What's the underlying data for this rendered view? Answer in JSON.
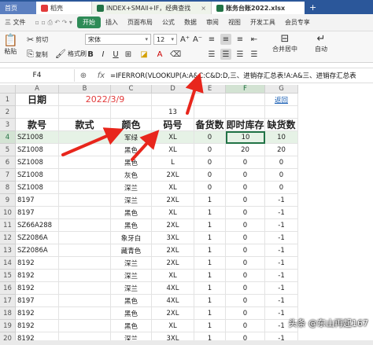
{
  "tabs": [
    {
      "label": "首页",
      "kind": "home"
    },
    {
      "label": "稻壳",
      "kind": "doc"
    },
    {
      "label": "INDEX+SMAll+IF，经典查找",
      "kind": "sheet1"
    },
    {
      "label": "账务台账2022.xlsx",
      "kind": "sheet2"
    }
  ],
  "tab_add": "+",
  "menu": {
    "file": "三 文件",
    "items": [
      "开始",
      "插入",
      "页面布局",
      "公式",
      "数据",
      "审阅",
      "视图",
      "开发工具",
      "会员专享"
    ],
    "active": "开始"
  },
  "ribbon": {
    "cut": "剪切",
    "paste": "粘贴",
    "copy": "复制",
    "format_painter": "格式刷",
    "font_name": "宋体",
    "font_size": "12",
    "merge": "合并居中",
    "wrap": "自动"
  },
  "formula_bar": {
    "name_box": "F4",
    "fx": "fx",
    "formula": "=IFERROR(VLOOKUP(A:A&C:C&D:D,三、进销存汇总表!A:A&三、进销存汇总表"
  },
  "columns": [
    "A",
    "B",
    "C",
    "D",
    "E",
    "F",
    "G"
  ],
  "rows": [
    "1",
    "2",
    "3",
    "4",
    "5",
    "6",
    "7",
    "8",
    "9",
    "10",
    "11",
    "12",
    "13",
    "14",
    "15",
    "16",
    "17",
    "18",
    "19",
    "20"
  ],
  "cells": {
    "a1": "日期",
    "b1": "2022/3/9",
    "g1": "返回",
    "d2": "13",
    "a3": "款号",
    "b3": "款式",
    "c3": "颜色",
    "d3": "码号",
    "e3": "备货数",
    "f3": "即时库存",
    "g3": "缺货数"
  },
  "table": [
    {
      "code": "SZ1008",
      "color": "军绿",
      "size": "XL",
      "stock": "0",
      "inv": "10",
      "short": "10"
    },
    {
      "code": "SZ1008",
      "color": "黑色",
      "size": "XL",
      "stock": "0",
      "inv": "20",
      "short": "20"
    },
    {
      "code": "SZ1008",
      "color": "黑色",
      "size": "L",
      "stock": "0",
      "inv": "0",
      "short": "0"
    },
    {
      "code": "SZ1008",
      "color": "灰色",
      "size": "2XL",
      "stock": "0",
      "inv": "0",
      "short": "0"
    },
    {
      "code": "SZ1008",
      "color": "深兰",
      "size": "XL",
      "stock": "0",
      "inv": "0",
      "short": "0"
    },
    {
      "code": "8197",
      "color": "深兰",
      "size": "2XL",
      "stock": "1",
      "inv": "0",
      "short": "-1"
    },
    {
      "code": "8197",
      "color": "黑色",
      "size": "XL",
      "stock": "1",
      "inv": "0",
      "short": "-1"
    },
    {
      "code": "SZ66A288",
      "color": "黑色",
      "size": "2XL",
      "stock": "1",
      "inv": "0",
      "short": "-1"
    },
    {
      "code": "SZ2086A",
      "color": "象牙白",
      "size": "3XL",
      "stock": "1",
      "inv": "0",
      "short": "-1"
    },
    {
      "code": "SZ2086A",
      "color": "藏青色",
      "size": "2XL",
      "stock": "1",
      "inv": "0",
      "short": "-1"
    },
    {
      "code": "8192",
      "color": "深兰",
      "size": "2XL",
      "stock": "1",
      "inv": "0",
      "short": "-1"
    },
    {
      "code": "8192",
      "color": "深兰",
      "size": "XL",
      "stock": "1",
      "inv": "0",
      "short": "-1"
    },
    {
      "code": "8192",
      "color": "深兰",
      "size": "4XL",
      "stock": "1",
      "inv": "0",
      "short": "-1"
    },
    {
      "code": "8197",
      "color": "黑色",
      "size": "4XL",
      "stock": "1",
      "inv": "0",
      "short": "-1"
    },
    {
      "code": "8192",
      "color": "黑色",
      "size": "2XL",
      "stock": "1",
      "inv": "0",
      "short": "-1"
    },
    {
      "code": "8192",
      "color": "黑色",
      "size": "XL",
      "stock": "1",
      "inv": "0",
      "short": "-1"
    },
    {
      "code": "8192",
      "color": "深兰",
      "size": "3XL",
      "stock": "1",
      "inv": "0",
      "short": "-1"
    }
  ],
  "watermark": "头条 @东山再起167",
  "colors": {
    "tab_bar": "#2b579a",
    "active_menu": "#2e8b57",
    "arrow": "#e8261c",
    "date": "#e23b3b",
    "link": "#1a5fb4",
    "selection": "#217346"
  }
}
